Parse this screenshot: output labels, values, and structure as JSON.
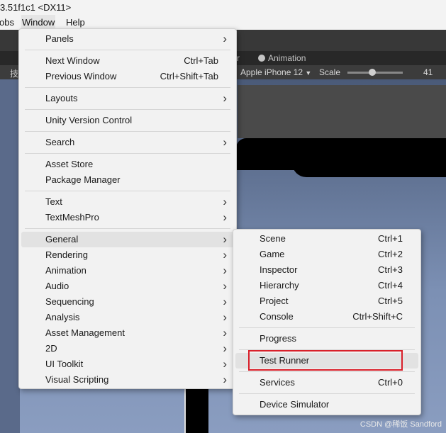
{
  "window": {
    "title": "3.51f1c1 <DX11>"
  },
  "menubar": {
    "items": [
      "obs",
      "Window",
      "Help"
    ]
  },
  "editor": {
    "tabs": [
      "r",
      "Animation"
    ],
    "toolbar": {
      "left_char": "技",
      "device": "Apple iPhone 12",
      "scale_label": "Scale",
      "scale_value": "41",
      "scale_level": 0.45
    }
  },
  "window_menu": {
    "items": [
      {
        "label": "Panels",
        "submenu": true
      },
      {
        "separator": true
      },
      {
        "label": "Next Window",
        "shortcut": "Ctrl+Tab"
      },
      {
        "label": "Previous Window",
        "shortcut": "Ctrl+Shift+Tab"
      },
      {
        "separator": true
      },
      {
        "label": "Layouts",
        "submenu": true
      },
      {
        "separator": true
      },
      {
        "label": "Unity Version Control"
      },
      {
        "separator": true
      },
      {
        "label": "Search",
        "submenu": true
      },
      {
        "separator": true
      },
      {
        "label": "Asset Store"
      },
      {
        "label": "Package Manager"
      },
      {
        "separator": true
      },
      {
        "label": "Text",
        "submenu": true
      },
      {
        "label": "TextMeshPro",
        "submenu": true
      },
      {
        "separator": true
      },
      {
        "label": "General",
        "submenu": true,
        "highlighted": true
      },
      {
        "label": "Rendering",
        "submenu": true
      },
      {
        "label": "Animation",
        "submenu": true
      },
      {
        "label": "Audio",
        "submenu": true
      },
      {
        "label": "Sequencing",
        "submenu": true
      },
      {
        "label": "Analysis",
        "submenu": true
      },
      {
        "label": "Asset Management",
        "submenu": true
      },
      {
        "label": "2D",
        "submenu": true
      },
      {
        "label": "UI Toolkit",
        "submenu": true
      },
      {
        "label": "Visual Scripting",
        "submenu": true
      }
    ]
  },
  "general_submenu": {
    "items": [
      {
        "label": "Scene",
        "shortcut": "Ctrl+1"
      },
      {
        "label": "Game",
        "shortcut": "Ctrl+2"
      },
      {
        "label": "Inspector",
        "shortcut": "Ctrl+3"
      },
      {
        "label": "Hierarchy",
        "shortcut": "Ctrl+4"
      },
      {
        "label": "Project",
        "shortcut": "Ctrl+5"
      },
      {
        "label": "Console",
        "shortcut": "Ctrl+Shift+C"
      },
      {
        "separator": true
      },
      {
        "label": "Progress"
      },
      {
        "separator": true
      },
      {
        "label": "Test Runner",
        "highlighted": true,
        "annotated": true
      },
      {
        "separator": true
      },
      {
        "label": "Services",
        "shortcut": "Ctrl+0"
      },
      {
        "separator": true
      },
      {
        "label": "Device Simulator"
      }
    ]
  },
  "watermark": "CSDN @稀饭 Sandford",
  "colors": {
    "annotation": "#d9202a",
    "menu_bg": "#f2f2f2",
    "highlight": "#e2e2e2"
  },
  "icons": {
    "submenu_arrow": "chevron-right-icon",
    "animation_tab": "clock-icon",
    "device_dropdown": "caret-down-icon"
  }
}
